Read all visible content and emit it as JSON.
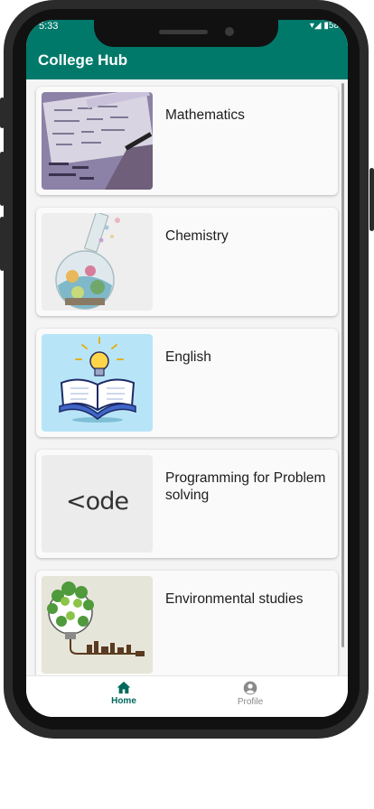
{
  "status_bar": {
    "time": "5:33",
    "right": "▾◢ ▮58"
  },
  "app_bar": {
    "title": "College Hub"
  },
  "subjects": [
    {
      "name": "Mathematics",
      "icon": "math-notes-image"
    },
    {
      "name": "Chemistry",
      "icon": "chemistry-flask-image"
    },
    {
      "name": "English",
      "icon": "open-book-lightbulb-image"
    },
    {
      "name": "Programming for Problem solving",
      "icon": "code-logo-image",
      "logo_text": "<ode"
    },
    {
      "name": "Environmental studies",
      "icon": "eco-lightbulb-image"
    }
  ],
  "bottom_nav": {
    "home": {
      "label": "Home",
      "icon": "home-icon",
      "active": true
    },
    "profile": {
      "label": "Profile",
      "icon": "account-circle-icon",
      "active": false
    }
  },
  "colors": {
    "primary": "#00796b",
    "active_nav": "#00695c",
    "inactive_nav": "#8a8a8a"
  }
}
